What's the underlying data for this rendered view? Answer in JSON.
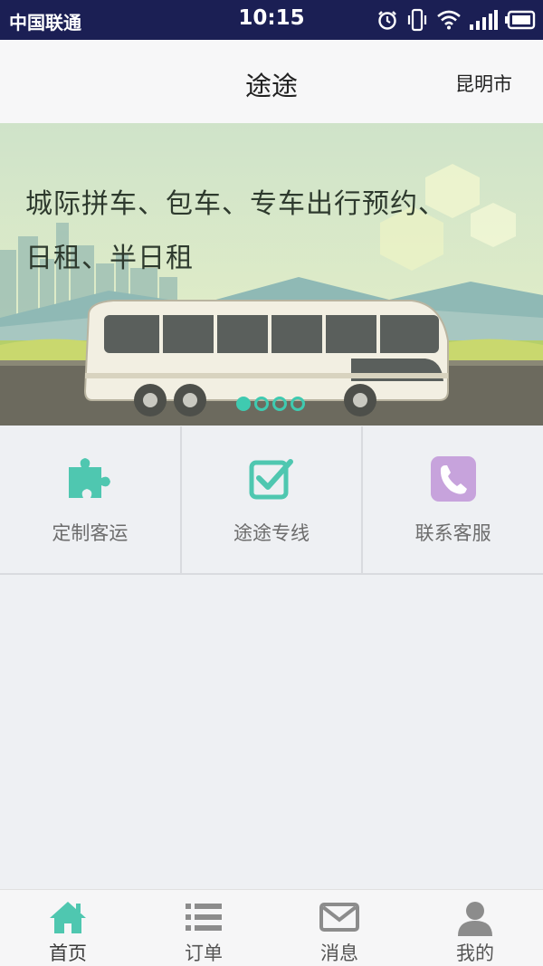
{
  "status_bar": {
    "carrier": "中国联通",
    "time": "10:15",
    "icons": [
      "alarm-icon",
      "vibrate-icon",
      "wifi-icon",
      "signal-icon",
      "battery-icon"
    ]
  },
  "header": {
    "title": "途途",
    "city": "昆明市"
  },
  "banner": {
    "line1": "城际拼车、包车、专车出行预约、",
    "line2": "日租、半日租",
    "slide_count": 4,
    "active_slide": 1
  },
  "actions": [
    {
      "label": "定制客运",
      "icon": "puzzle-icon",
      "color": "#4fc7b0"
    },
    {
      "label": "途途专线",
      "icon": "checkbox-icon",
      "color": "#4fc7b0"
    },
    {
      "label": "联系客服",
      "icon": "phone-icon",
      "color": "#c7a3dc"
    }
  ],
  "bottom_nav": [
    {
      "label": "首页",
      "icon": "home-icon",
      "active": true
    },
    {
      "label": "订单",
      "icon": "list-icon",
      "active": false
    },
    {
      "label": "消息",
      "icon": "mail-icon",
      "active": false
    },
    {
      "label": "我的",
      "icon": "user-icon",
      "active": false
    }
  ],
  "colors": {
    "accent": "#3fcab0",
    "status_bar": "#1b1f54",
    "nav_inactive": "#8c8c8c"
  }
}
